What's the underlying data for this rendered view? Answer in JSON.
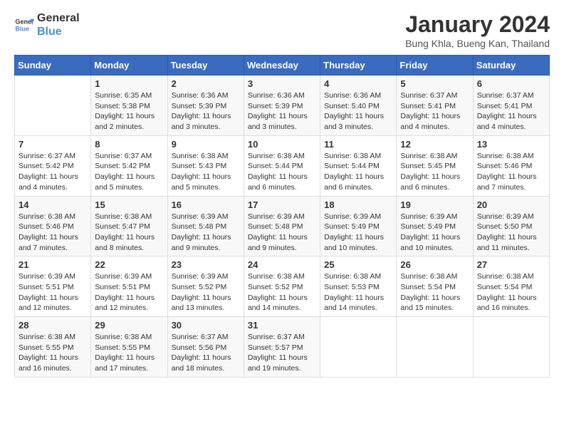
{
  "header": {
    "logo_line1": "General",
    "logo_line2": "Blue",
    "month_title": "January 2024",
    "location": "Bung Khla, Bueng Kan, Thailand"
  },
  "days_of_week": [
    "Sunday",
    "Monday",
    "Tuesday",
    "Wednesday",
    "Thursday",
    "Friday",
    "Saturday"
  ],
  "weeks": [
    [
      {
        "day": "",
        "info": ""
      },
      {
        "day": "1",
        "info": "Sunrise: 6:35 AM\nSunset: 5:38 PM\nDaylight: 11 hours\nand 2 minutes."
      },
      {
        "day": "2",
        "info": "Sunrise: 6:36 AM\nSunset: 5:39 PM\nDaylight: 11 hours\nand 3 minutes."
      },
      {
        "day": "3",
        "info": "Sunrise: 6:36 AM\nSunset: 5:39 PM\nDaylight: 11 hours\nand 3 minutes."
      },
      {
        "day": "4",
        "info": "Sunrise: 6:36 AM\nSunset: 5:40 PM\nDaylight: 11 hours\nand 3 minutes."
      },
      {
        "day": "5",
        "info": "Sunrise: 6:37 AM\nSunset: 5:41 PM\nDaylight: 11 hours\nand 4 minutes."
      },
      {
        "day": "6",
        "info": "Sunrise: 6:37 AM\nSunset: 5:41 PM\nDaylight: 11 hours\nand 4 minutes."
      }
    ],
    [
      {
        "day": "7",
        "info": "Sunrise: 6:37 AM\nSunset: 5:42 PM\nDaylight: 11 hours\nand 4 minutes."
      },
      {
        "day": "8",
        "info": "Sunrise: 6:37 AM\nSunset: 5:42 PM\nDaylight: 11 hours\nand 5 minutes."
      },
      {
        "day": "9",
        "info": "Sunrise: 6:38 AM\nSunset: 5:43 PM\nDaylight: 11 hours\nand 5 minutes."
      },
      {
        "day": "10",
        "info": "Sunrise: 6:38 AM\nSunset: 5:44 PM\nDaylight: 11 hours\nand 6 minutes."
      },
      {
        "day": "11",
        "info": "Sunrise: 6:38 AM\nSunset: 5:44 PM\nDaylight: 11 hours\nand 6 minutes."
      },
      {
        "day": "12",
        "info": "Sunrise: 6:38 AM\nSunset: 5:45 PM\nDaylight: 11 hours\nand 6 minutes."
      },
      {
        "day": "13",
        "info": "Sunrise: 6:38 AM\nSunset: 5:46 PM\nDaylight: 11 hours\nand 7 minutes."
      }
    ],
    [
      {
        "day": "14",
        "info": "Sunrise: 6:38 AM\nSunset: 5:46 PM\nDaylight: 11 hours\nand 7 minutes."
      },
      {
        "day": "15",
        "info": "Sunrise: 6:38 AM\nSunset: 5:47 PM\nDaylight: 11 hours\nand 8 minutes."
      },
      {
        "day": "16",
        "info": "Sunrise: 6:39 AM\nSunset: 5:48 PM\nDaylight: 11 hours\nand 9 minutes."
      },
      {
        "day": "17",
        "info": "Sunrise: 6:39 AM\nSunset: 5:48 PM\nDaylight: 11 hours\nand 9 minutes."
      },
      {
        "day": "18",
        "info": "Sunrise: 6:39 AM\nSunset: 5:49 PM\nDaylight: 11 hours\nand 10 minutes."
      },
      {
        "day": "19",
        "info": "Sunrise: 6:39 AM\nSunset: 5:49 PM\nDaylight: 11 hours\nand 10 minutes."
      },
      {
        "day": "20",
        "info": "Sunrise: 6:39 AM\nSunset: 5:50 PM\nDaylight: 11 hours\nand 11 minutes."
      }
    ],
    [
      {
        "day": "21",
        "info": "Sunrise: 6:39 AM\nSunset: 5:51 PM\nDaylight: 11 hours\nand 12 minutes."
      },
      {
        "day": "22",
        "info": "Sunrise: 6:39 AM\nSunset: 5:51 PM\nDaylight: 11 hours\nand 12 minutes."
      },
      {
        "day": "23",
        "info": "Sunrise: 6:39 AM\nSunset: 5:52 PM\nDaylight: 11 hours\nand 13 minutes."
      },
      {
        "day": "24",
        "info": "Sunrise: 6:38 AM\nSunset: 5:52 PM\nDaylight: 11 hours\nand 14 minutes."
      },
      {
        "day": "25",
        "info": "Sunrise: 6:38 AM\nSunset: 5:53 PM\nDaylight: 11 hours\nand 14 minutes."
      },
      {
        "day": "26",
        "info": "Sunrise: 6:38 AM\nSunset: 5:54 PM\nDaylight: 11 hours\nand 15 minutes."
      },
      {
        "day": "27",
        "info": "Sunrise: 6:38 AM\nSunset: 5:54 PM\nDaylight: 11 hours\nand 16 minutes."
      }
    ],
    [
      {
        "day": "28",
        "info": "Sunrise: 6:38 AM\nSunset: 5:55 PM\nDaylight: 11 hours\nand 16 minutes."
      },
      {
        "day": "29",
        "info": "Sunrise: 6:38 AM\nSunset: 5:55 PM\nDaylight: 11 hours\nand 17 minutes."
      },
      {
        "day": "30",
        "info": "Sunrise: 6:37 AM\nSunset: 5:56 PM\nDaylight: 11 hours\nand 18 minutes."
      },
      {
        "day": "31",
        "info": "Sunrise: 6:37 AM\nSunset: 5:57 PM\nDaylight: 11 hours\nand 19 minutes."
      },
      {
        "day": "",
        "info": ""
      },
      {
        "day": "",
        "info": ""
      },
      {
        "day": "",
        "info": ""
      }
    ]
  ]
}
